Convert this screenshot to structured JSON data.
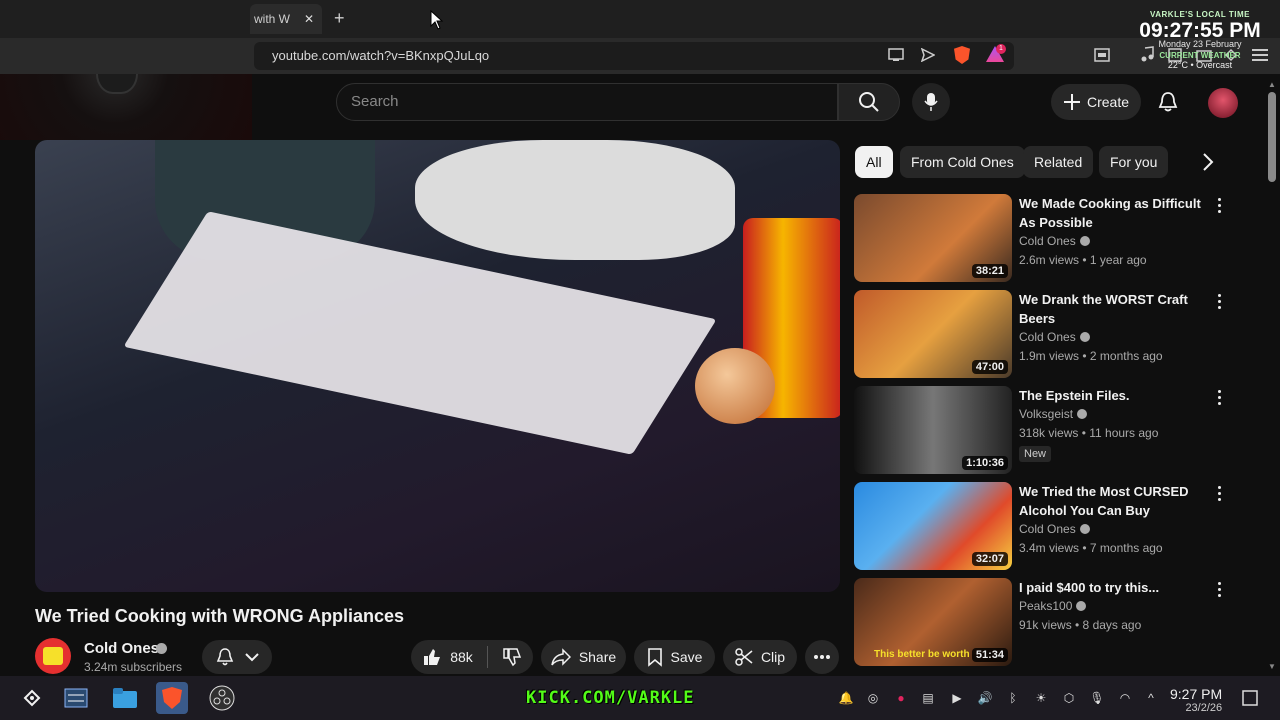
{
  "browser": {
    "tab_title": "with W",
    "tab_close": "✕",
    "new_tab": "+",
    "url": "youtube.com/watch?v=BKnxpQJuLqo",
    "rewards_badge": "1"
  },
  "overlay": {
    "label": "VARKLE'S LOCAL TIME",
    "time": "09:27:55 PM",
    "date": "Monday 23 February",
    "weather_label": "CURRENT WEATHER",
    "weather": "22°C • Overcast"
  },
  "youtube": {
    "search_placeholder": "Search",
    "create_label": "Create"
  },
  "video": {
    "title": "We Tried Cooking with WRONG Appliances",
    "channel": "Cold Ones",
    "subscribers": "3.24m subscribers",
    "likes": "88k",
    "share_label": "Share",
    "save_label": "Save",
    "clip_label": "Clip"
  },
  "chips": [
    "All",
    "From Cold Ones",
    "Related",
    "For you"
  ],
  "recommendations": [
    {
      "title": "We Made Cooking as Difficult As Possible",
      "channel": "Cold Ones",
      "meta": "2.6m views • 1 year ago",
      "duration": "38:21",
      "thumb_bg": "#6b4a30"
    },
    {
      "title": "We Drank the WORST Craft Beers",
      "channel": "Cold Ones",
      "meta": "1.9m views • 2 months ago",
      "duration": "47:00",
      "thumb_bg": "#8a3a22"
    },
    {
      "title": "The Epstein Files.",
      "channel": "Volksgeist",
      "meta": "318k views • 11 hours ago",
      "duration": "1:10:36",
      "badge": "New",
      "thumb_bg": "#3a3a3a"
    },
    {
      "title": "We Tried the Most CURSED Alcohol You Can Buy",
      "channel": "Cold Ones",
      "meta": "3.4m views • 7 months ago",
      "duration": "32:07",
      "thumb_bg": "#2a7fd4"
    },
    {
      "title": "I paid $400 to try this...",
      "channel": "Peaks100",
      "meta": "91k views • 8 days ago",
      "duration": "51:34",
      "thumb_caption": "This better be worth",
      "thumb_bg": "#5a3a2a"
    }
  ],
  "taskbar": {
    "kick": "KICK.COM/VARKLE",
    "time": "9:27 PM",
    "date": "23/2/26"
  }
}
